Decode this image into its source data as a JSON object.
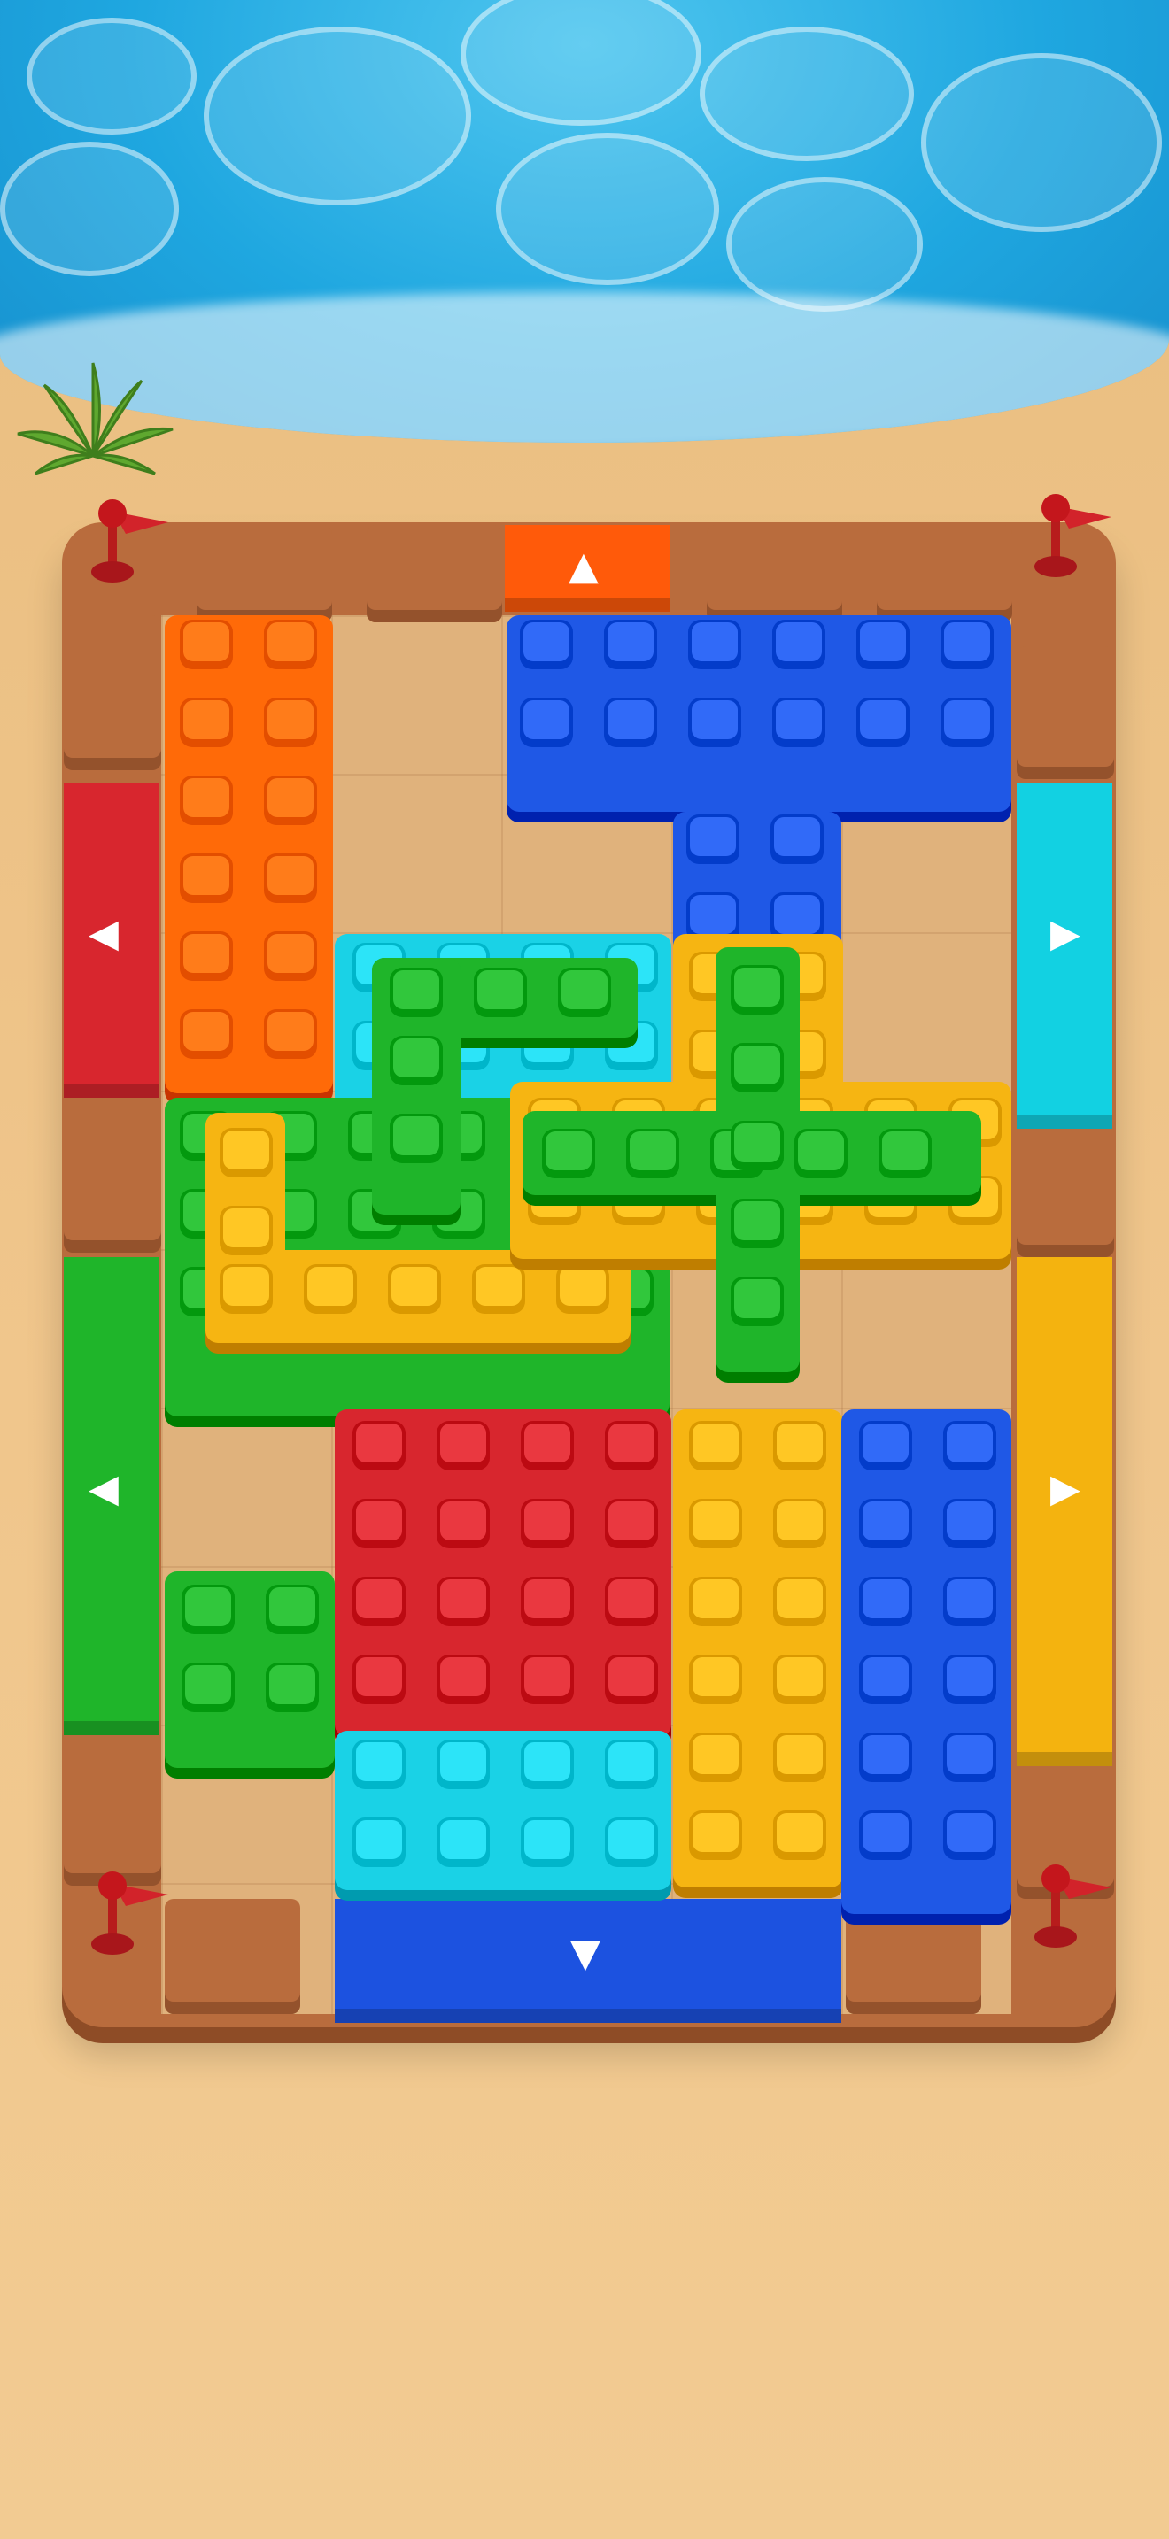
{
  "colors": {
    "orange": "#ff6a08",
    "blue": "#1f58e6",
    "cyan": "#1ad2e6",
    "green": "#1fb52a",
    "yellow": "#f6b512",
    "red": "#d8262e",
    "brick": "#b96c3d",
    "board": "#e0b27c"
  },
  "gates": {
    "top": {
      "color": "orange",
      "arrow": "▲"
    },
    "left_upper": {
      "color": "red",
      "arrow": "◀"
    },
    "left_lower": {
      "color": "green",
      "arrow": "◀"
    },
    "right_upper": {
      "color": "cyan",
      "arrow": "▶"
    },
    "right_lower": {
      "color": "yellow",
      "arrow": "▶"
    },
    "bottom": {
      "color": "blue",
      "arrow": "▼"
    }
  },
  "blocks": [
    {
      "name": "orange-vertical-block",
      "color": "orange",
      "shape": "2x6 bar"
    },
    {
      "name": "blue-t-block",
      "color": "blue",
      "shape": "T"
    },
    {
      "name": "cyan-square-block",
      "color": "cyan",
      "shape": "2x2"
    },
    {
      "name": "green-large-block",
      "color": "green",
      "shape": "L"
    },
    {
      "name": "green-l-block",
      "color": "green",
      "shape": "L"
    },
    {
      "name": "yellow-l-block",
      "color": "yellow",
      "shape": "L"
    },
    {
      "name": "yellow-cross-block",
      "color": "yellow",
      "shape": "cross"
    },
    {
      "name": "green-plus-block",
      "color": "green",
      "shape": "plus"
    },
    {
      "name": "red-square-block",
      "color": "red",
      "shape": "4x4"
    },
    {
      "name": "yellow-vertical-block",
      "color": "yellow",
      "shape": "2x6 bar"
    },
    {
      "name": "blue-vertical-block",
      "color": "blue",
      "shape": "2x6 bar"
    },
    {
      "name": "green-small-block",
      "color": "green",
      "shape": "2x2"
    },
    {
      "name": "cyan-horizontal-block",
      "color": "cyan",
      "shape": "4x2 bar"
    }
  ]
}
